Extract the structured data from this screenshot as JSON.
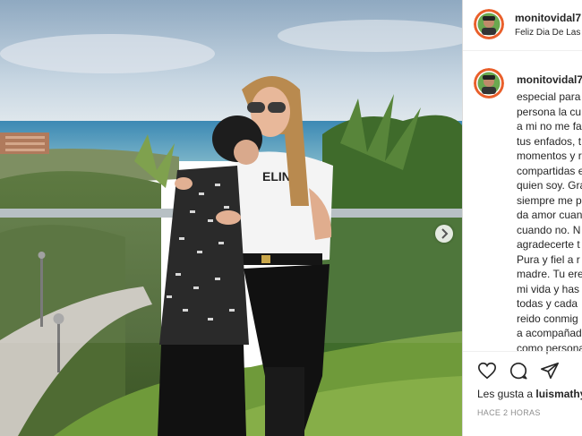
{
  "post": {
    "username": "monitovidal7",
    "subtitle": "Feliz Dia De Las",
    "caption_username": "monitovidal7",
    "caption_lines": [
      "especial para",
      "persona la cu",
      "a mi no me fa",
      "tus enfados, t",
      "momentos y r",
      "compartidas e",
      "quien soy. Gra",
      "siempre me p",
      "da amor cuan",
      "cuando no. N",
      "agradecerte t",
      "Pura y fiel a r",
      "madre. Tu ere",
      "mi vida y has",
      "todas y cada",
      "reido conmig",
      "a acompañad",
      "como persona"
    ],
    "likes_prefix": "Les gusta a ",
    "likes_user": "luismathy",
    "timestamp": "HACE 2 HORAS"
  },
  "icons": {
    "like": "heart-icon",
    "comment": "comment-icon",
    "share": "share-icon",
    "next": "chevron-right-icon"
  },
  "colors": {
    "text": "#262626",
    "muted": "#8e8e8e",
    "border": "#dbdbdb"
  }
}
